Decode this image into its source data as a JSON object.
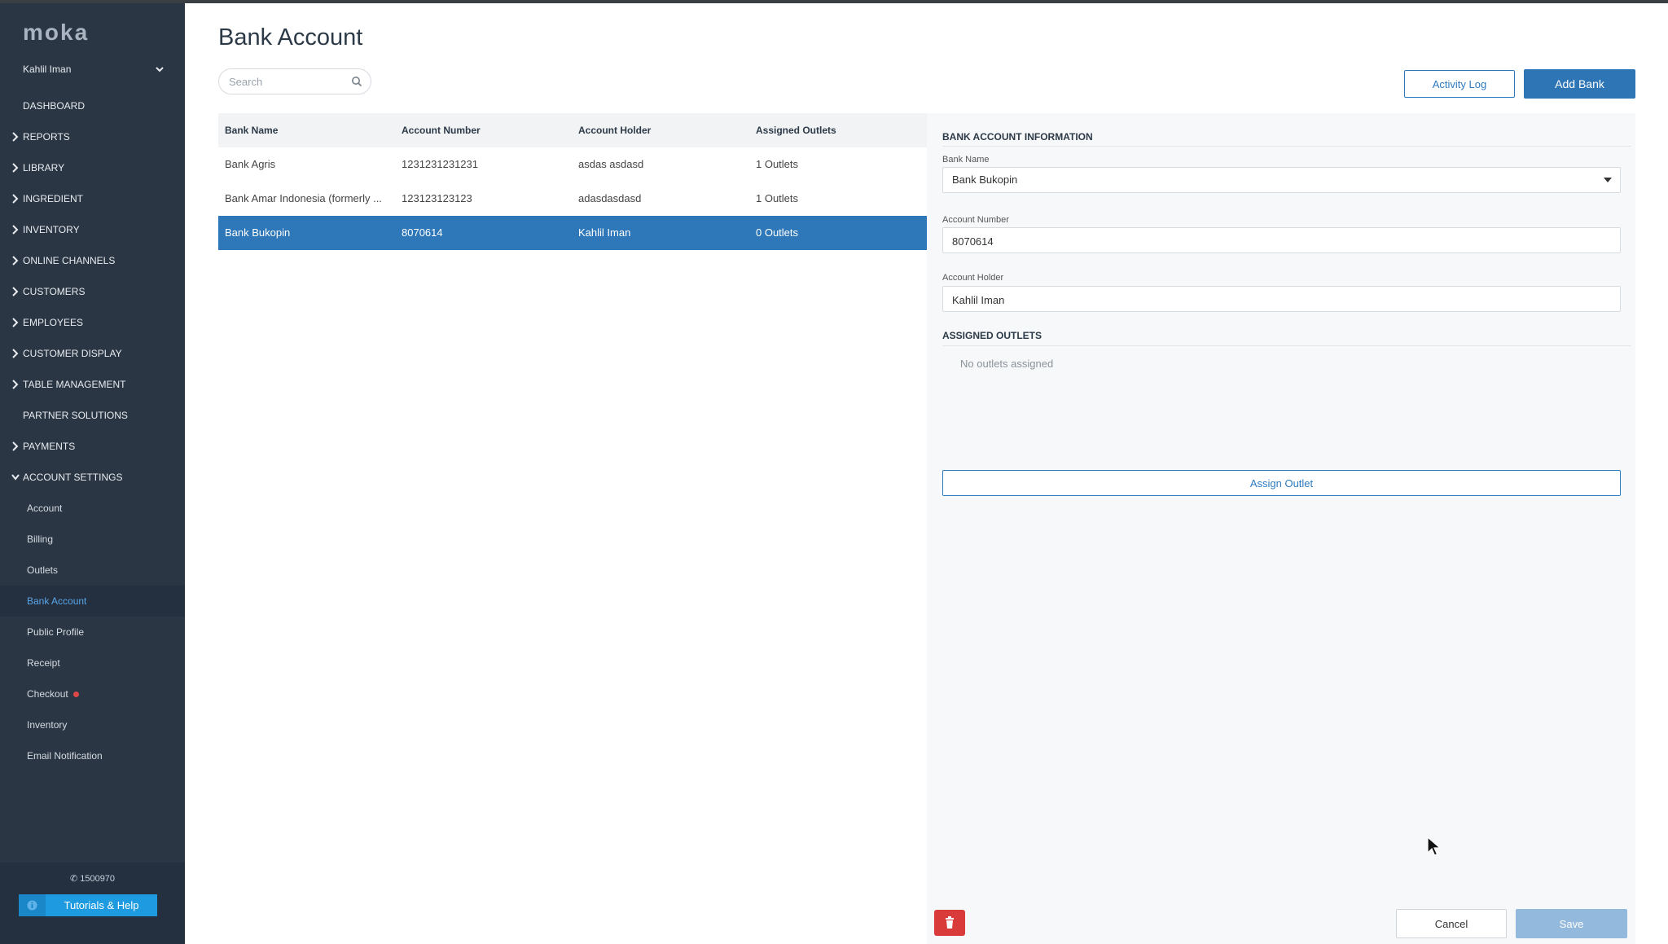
{
  "app": {
    "logo_text": "moka"
  },
  "sidebar": {
    "user_name": "Kahlil Iman",
    "nav": [
      {
        "label": "DASHBOARD",
        "arrow": false
      },
      {
        "label": "REPORTS",
        "arrow": true
      },
      {
        "label": "LIBRARY",
        "arrow": true
      },
      {
        "label": "INGREDIENT",
        "arrow": true
      },
      {
        "label": "INVENTORY",
        "arrow": true
      },
      {
        "label": "ONLINE CHANNELS",
        "arrow": true
      },
      {
        "label": "CUSTOMERS",
        "arrow": true
      },
      {
        "label": "EMPLOYEES",
        "arrow": true
      },
      {
        "label": "CUSTOMER DISPLAY",
        "arrow": true
      },
      {
        "label": "TABLE MANAGEMENT",
        "arrow": true
      },
      {
        "label": "PARTNER SOLUTIONS",
        "arrow": false
      },
      {
        "label": "PAYMENTS",
        "arrow": true
      },
      {
        "label": "ACCOUNT SETTINGS",
        "arrow": true,
        "expanded": true
      }
    ],
    "account_settings_items": [
      "Account",
      "Billing",
      "Outlets",
      "Bank Account",
      "Public Profile",
      "Receipt",
      "Checkout",
      "Inventory",
      "Email Notification"
    ],
    "active_item": "Bank Account",
    "phone": "1500970",
    "help_label": "Tutorials & Help"
  },
  "main": {
    "title": "Bank Account",
    "search_placeholder": "Search",
    "activity_log_label": "Activity Log",
    "add_bank_label": "Add Bank",
    "columns": [
      "Bank Name",
      "Account Number",
      "Account Holder",
      "Assigned Outlets"
    ],
    "rows": [
      [
        "Bank Agris",
        "1231231231231",
        "asdas asdasd",
        "1 Outlets"
      ],
      [
        "Bank Amar Indonesia (formerly ...",
        "123123123123",
        "adasdasdasd",
        "1 Outlets"
      ],
      [
        "Bank Bukopin",
        "8070614",
        "Kahlil Iman",
        "0 Outlets"
      ]
    ],
    "selected_row": 2
  },
  "detail": {
    "section_title": "BANK ACCOUNT INFORMATION",
    "bank_name_label": "Bank Name",
    "bank_name_value": "Bank Bukopin",
    "account_number_label": "Account Number",
    "account_number_value": "8070614",
    "account_holder_label": "Account Holder",
    "account_holder_value": "Kahlil Iman",
    "outlets_title": "ASSIGNED OUTLETS",
    "no_outlets_text": "No outlets assigned",
    "assign_outlet_label": "Assign Outlet",
    "cancel_label": "Cancel",
    "save_label": "Save"
  },
  "colors": {
    "sidebar_bg": "#2a3644",
    "accent": "#2e75b6",
    "selected_row": "#2e77b8",
    "danger": "#d93a3a",
    "help_button": "#1e9be0"
  }
}
